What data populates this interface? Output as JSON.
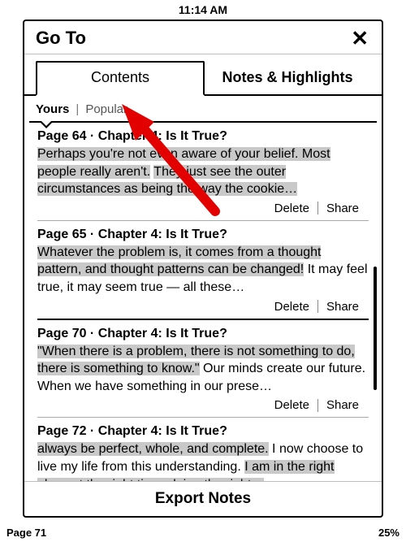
{
  "status": {
    "time": "11:14 AM"
  },
  "modal": {
    "title": "Go To",
    "close_glyph": "✕",
    "tabs": {
      "contents": "Contents",
      "notes": "Notes & Highlights"
    },
    "subtabs": {
      "yours": "Yours",
      "sep": "|",
      "popular": "Popular"
    },
    "export_label": "Export Notes",
    "action_delete": "Delete",
    "action_share": "Share"
  },
  "notes": [
    {
      "header": "Page 64 · Chapter 4: Is It True?",
      "body_parts": [
        {
          "t": "Perhaps you're not even aware of your belief. Most people really aren't.",
          "hl": true
        },
        {
          "t": " ",
          "hl": false
        },
        {
          "t": "They just see the outer circumstances as being the way the cookie…",
          "hl": true
        }
      ]
    },
    {
      "header": "Page 65 · Chapter 4: Is It True?",
      "body_parts": [
        {
          "t": "Whatever the problem is, it comes from a thought pattern, and thought patterns can be changed!",
          "hl": true
        },
        {
          "t": " It may feel true, it may seem true — all these…",
          "hl": false
        }
      ]
    },
    {
      "header": "Page 70 · Chapter 4: Is It True?",
      "body_parts": [
        {
          "t": "\"When there is a problem, there is not something to do, there is something to know.\"",
          "hl": true
        },
        {
          "t": " Our minds create our future. When we have something in our prese…",
          "hl": false
        }
      ]
    },
    {
      "header": "Page 72 · Chapter 4: Is It True?",
      "body_parts": [
        {
          "t": "always be perfect, whole, and complete.",
          "hl": true
        },
        {
          "t": " I now choose to live my life from this understanding. ",
          "hl": false
        },
        {
          "t": "I am in the right place at the right time, doing the right…",
          "hl": true
        }
      ]
    }
  ],
  "footer": {
    "page": "Page 71",
    "percent": "25%"
  },
  "colors": {
    "highlight": "#c9c9c9"
  }
}
